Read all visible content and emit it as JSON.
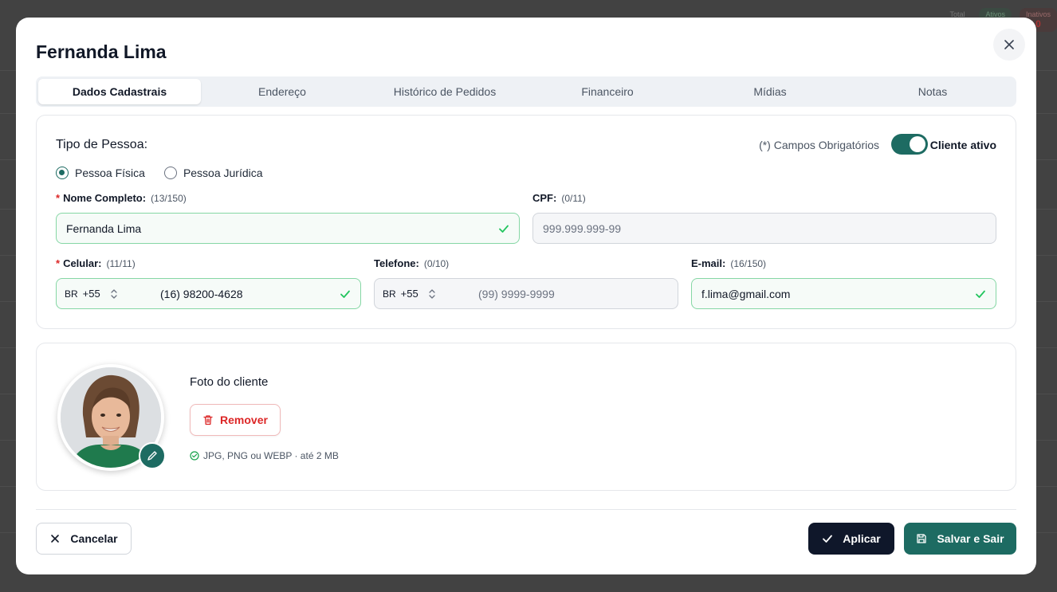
{
  "background": {
    "stats": [
      {
        "label": "Total",
        "value": ""
      },
      {
        "label": "Ativos",
        "value": ""
      },
      {
        "label": "Inativos",
        "value": "0"
      }
    ]
  },
  "modal": {
    "title": "Fernanda Lima",
    "close_icon": "close-icon"
  },
  "tabs": [
    {
      "label": "Dados Cadastrais",
      "active": true
    },
    {
      "label": "Endereço",
      "active": false
    },
    {
      "label": "Histórico de Pedidos",
      "active": false
    },
    {
      "label": "Financeiro",
      "active": false
    },
    {
      "label": "Mídias",
      "active": false
    },
    {
      "label": "Notas",
      "active": false
    }
  ],
  "form": {
    "tipo_pessoa_label": "Tipo de Pessoa:",
    "required_note": "(*) Campos Obrigatórios",
    "cliente_ativo_label": "Cliente ativo",
    "cliente_ativo": true,
    "radio_options": [
      {
        "label": "Pessoa Física",
        "checked": true
      },
      {
        "label": "Pessoa Jurídica",
        "checked": false
      }
    ],
    "nome": {
      "star": "*",
      "label": "Nome Completo:",
      "count": "(13/150)",
      "value": "Fernanda Lima"
    },
    "cpf": {
      "label": "CPF:",
      "count": "(0/11)",
      "placeholder": "999.999.999-99"
    },
    "celular": {
      "star": "*",
      "label": "Celular:",
      "count": "(11/11)",
      "country": "BR",
      "ddi": "+55",
      "value": "(16) 98200-4628"
    },
    "telefone": {
      "label": "Telefone:",
      "count": "(0/10)",
      "country": "BR",
      "ddi": "+55",
      "placeholder": "(99) 9999-9999"
    },
    "email": {
      "label": "E-mail:",
      "count": "(16/150)",
      "value": "f.lima@gmail.com"
    }
  },
  "photo": {
    "title": "Foto do cliente",
    "remove_label": "Remover",
    "hint": "JPG, PNG ou WEBP · até 2 MB"
  },
  "footer": {
    "cancel_label": "Cancelar",
    "apply_label": "Aplicar",
    "save_label": "Salvar e Sair"
  },
  "colors": {
    "primary": "#1d6b62",
    "dark": "#0f172a",
    "danger": "#dc2626",
    "valid_border": "#86d7a5"
  }
}
